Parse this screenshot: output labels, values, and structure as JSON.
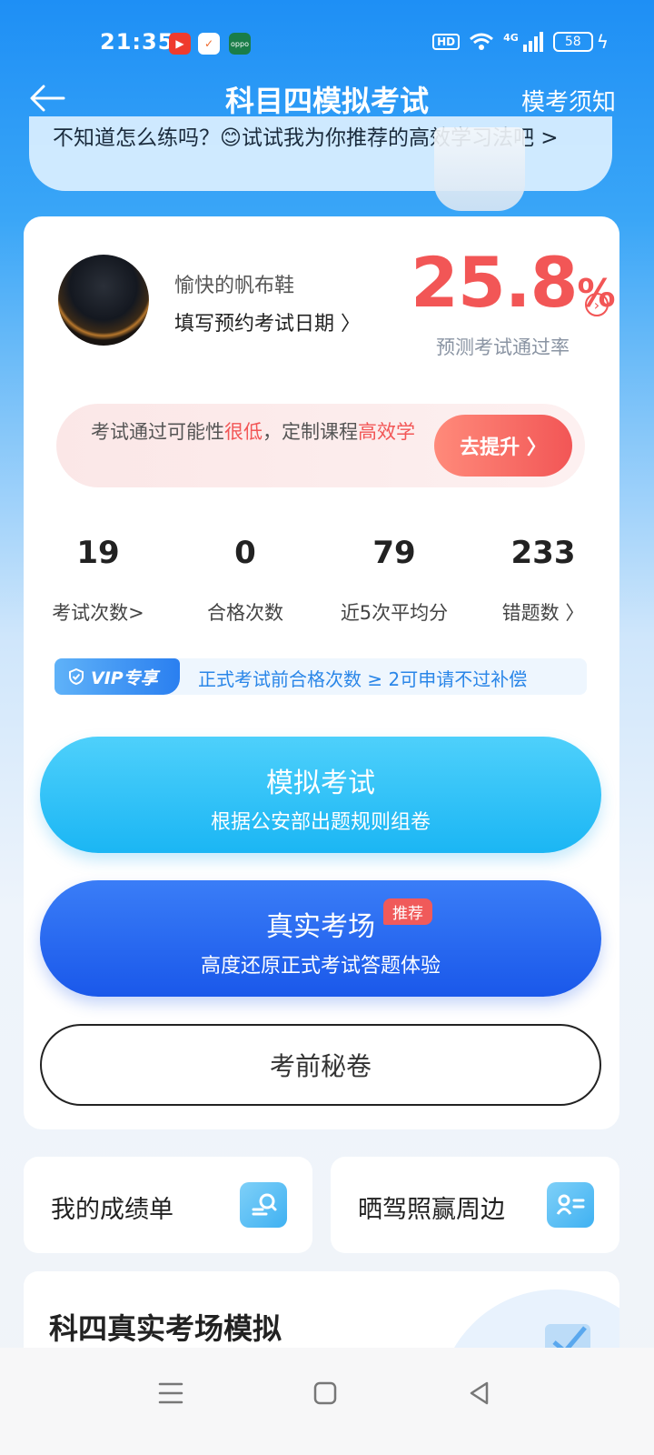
{
  "status": {
    "time": "21:35",
    "hd": "HD",
    "signal": "4G",
    "battery": "58"
  },
  "nav": {
    "title": "科目四模拟考试",
    "right_link": "模考须知"
  },
  "tip": {
    "text": "不知道怎么练吗？😊试试我为你推荐的高效学习法吧 >"
  },
  "profile": {
    "username": "愉快的帆布鞋",
    "exam_date_prompt": "填写预约考试日期 〉",
    "pass_rate_value": "25.8",
    "pass_rate_unit": "%",
    "pass_rate_label": "预测考试通过率"
  },
  "alert": {
    "text_before": "考试通过可能性",
    "text_low": "很低",
    "text_middle": "，定制课程",
    "text_efficient": "高效学",
    "button_label": "去提升 〉"
  },
  "stats": [
    {
      "value": "19",
      "label": "考试次数>"
    },
    {
      "value": "0",
      "label": "合格次数"
    },
    {
      "value": "79",
      "label": "近5次平均分"
    },
    {
      "value": "233",
      "label": "错题数 〉"
    }
  ],
  "vip": {
    "tag": "VIP专享",
    "text": "正式考试前合格次数 ≥ 2可申请不过补偿"
  },
  "buttons": {
    "mock_title": "模拟考试",
    "mock_sub": "根据公安部出题规则组卷",
    "real_title": "真实考场",
    "real_badge": "推荐",
    "real_sub": "高度还原正式考试答题体验",
    "secret": "考前秘卷"
  },
  "cards": {
    "report": "我的成绩单",
    "share": "晒驾照赢周边"
  },
  "section": {
    "title": "科四真实考场模拟"
  },
  "icons": {
    "back": "arrow-left-icon",
    "search_doc": "search-doc-icon",
    "id_card": "id-card-icon",
    "shield": "shield-check-icon"
  },
  "colors": {
    "primary_blue": "#1e8ff5",
    "danger_red": "#f25656",
    "mock_cyan": "#1bb6f4",
    "real_blue": "#1a58ea"
  }
}
